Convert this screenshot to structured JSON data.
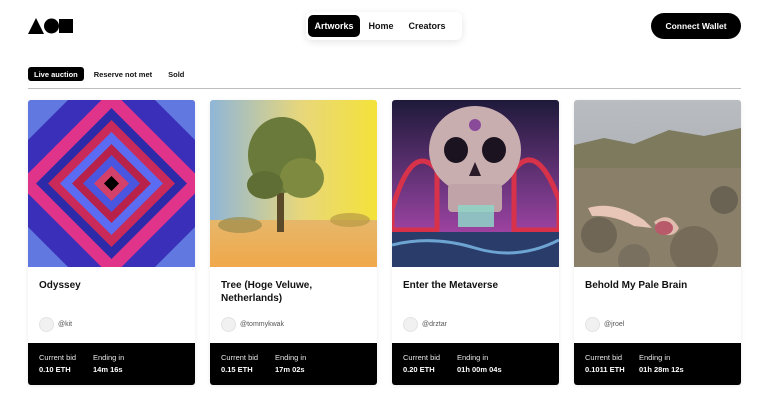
{
  "nav": {
    "items": [
      "Artworks",
      "Home",
      "Creators"
    ],
    "active": "Artworks"
  },
  "connect_label": "Connect Wallet",
  "filters": {
    "items": [
      "Live auction",
      "Reserve not met",
      "Sold"
    ],
    "active": "Live auction"
  },
  "cards": [
    {
      "title": "Odyssey",
      "creator": "@kit",
      "bid_label": "Current bid",
      "bid": "0.10 ETH",
      "ending_label": "Ending in",
      "ending": "14m  16s"
    },
    {
      "title": "Tree (Hoge Veluwe, Netherlands)",
      "creator": "@tommykwak",
      "bid_label": "Current bid",
      "bid": "0.15 ETH",
      "ending_label": "Ending in",
      "ending": "17m  02s"
    },
    {
      "title": "Enter the Metaverse",
      "creator": "@drztar",
      "bid_label": "Current bid",
      "bid": "0.20 ETH",
      "ending_label": "Ending in",
      "ending": "01h   00m 04s"
    },
    {
      "title": "Behold My Pale Brain",
      "creator": "@jroel",
      "bid_label": "Current bid",
      "bid": "0.1011 ETH",
      "ending_label": "Ending in",
      "ending": "01h   28m  12s"
    }
  ],
  "colors": {
    "accent": "#000000",
    "background": "#ffffff"
  }
}
